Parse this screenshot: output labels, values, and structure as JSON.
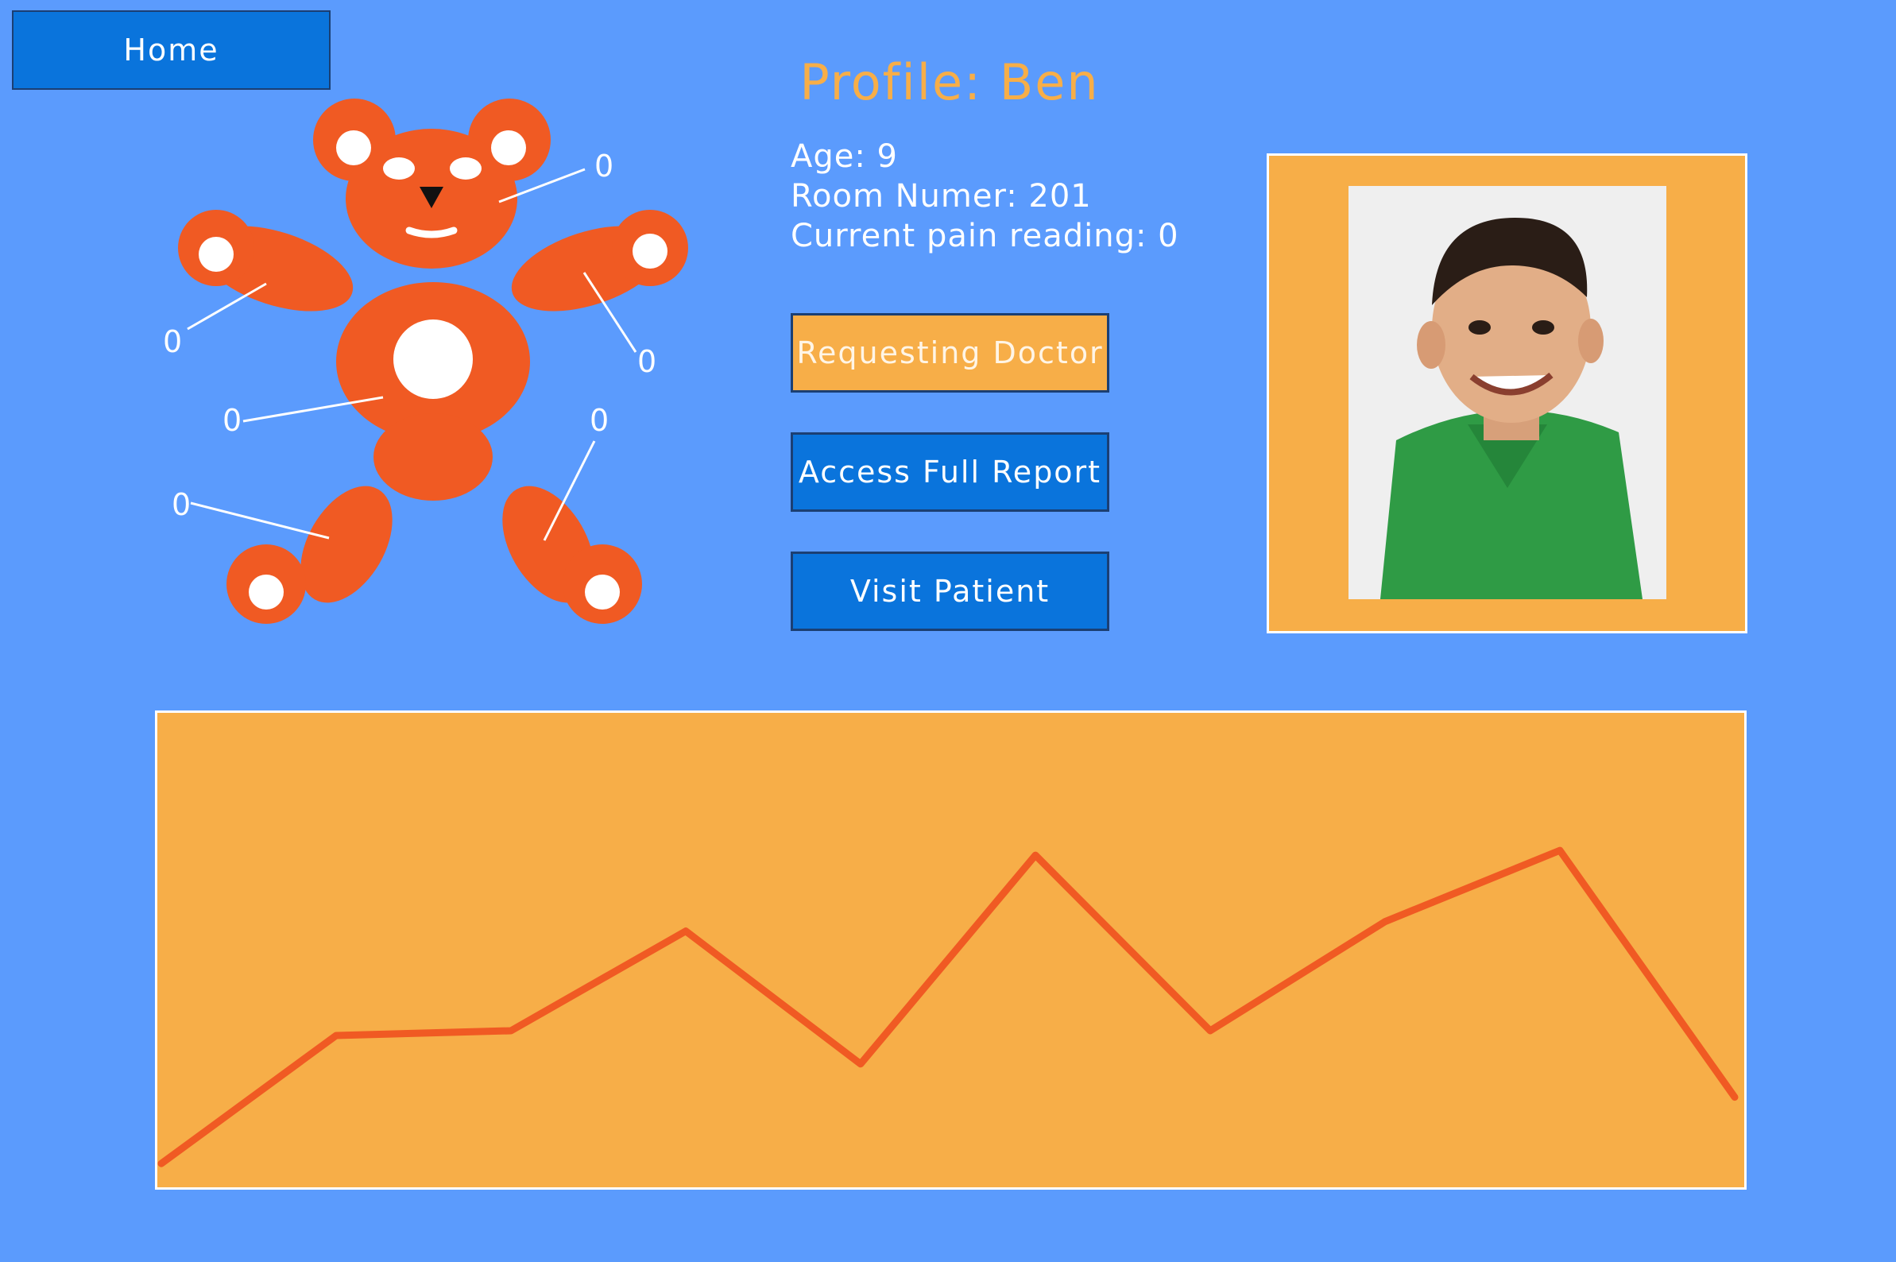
{
  "nav": {
    "home_label": "Home"
  },
  "profile": {
    "title": "Profile: Ben",
    "age": "Age: 9",
    "room": "Room Numer: 201",
    "current_pain": "Current pain reading: 0"
  },
  "actions": {
    "request_doctor": "Requesting Doctor",
    "access_report": "Access Full Report",
    "visit_patient": "Visit Patient"
  },
  "bear": {
    "icon": "teddy-bear-icon",
    "pain_readings": {
      "head": "0",
      "left_arm": "0",
      "right_arm": "0",
      "torso": "0",
      "left_leg": "0",
      "right_leg_upper": "0",
      "right_leg": "0"
    }
  },
  "colors": {
    "background": "#5b9bfd",
    "accent_orange": "#f7ae48",
    "bear_orange": "#f05a23",
    "button_blue": "#0a74dc"
  },
  "chart_data": {
    "type": "line",
    "title": "",
    "xlabel": "",
    "ylabel": "",
    "grid": false,
    "series": [
      {
        "values": [
          0.05,
          0.32,
          0.33,
          0.54,
          0.26,
          0.7,
          0.33,
          0.56,
          0.71,
          0.19
        ]
      }
    ]
  }
}
